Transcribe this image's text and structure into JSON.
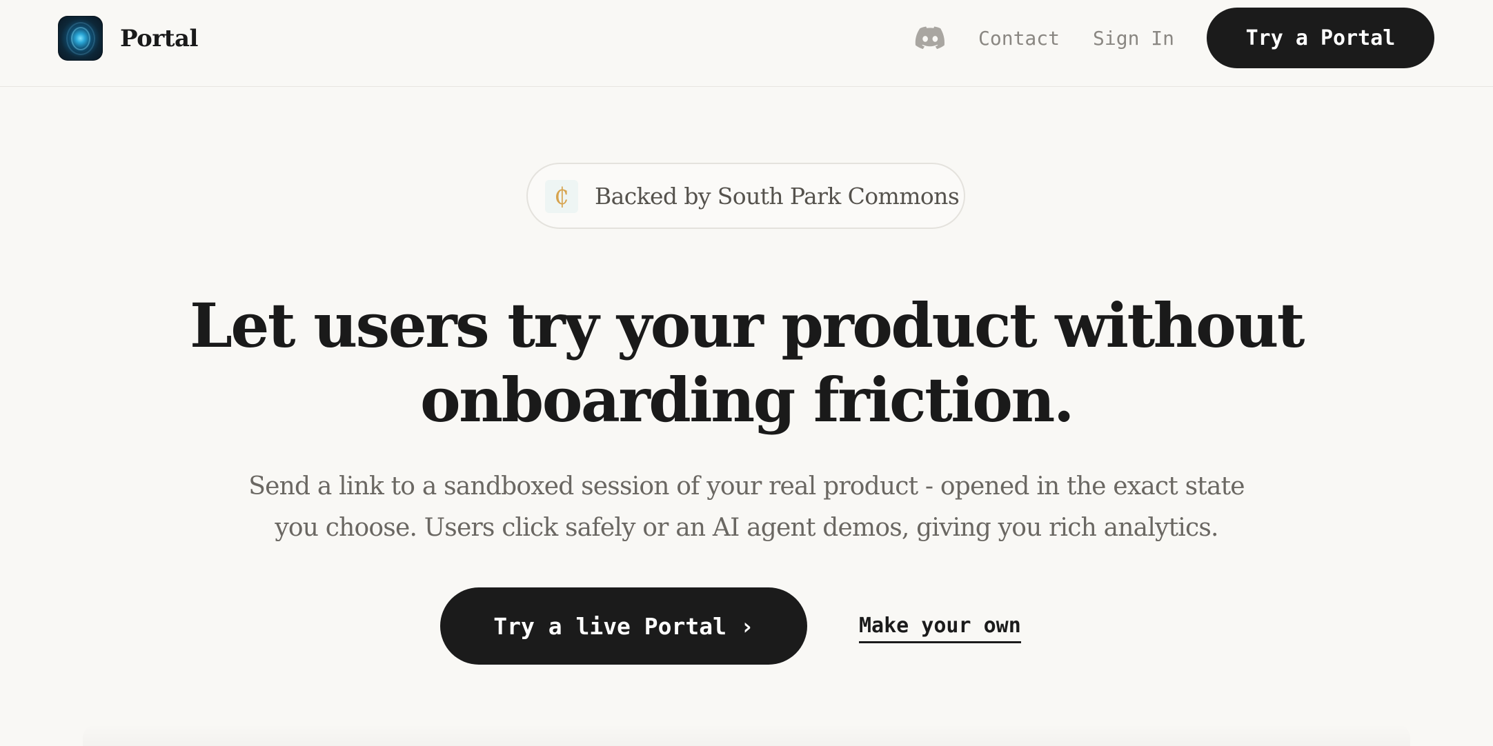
{
  "header": {
    "brand_name": "Portal",
    "nav": {
      "contact": "Contact",
      "sign_in": "Sign In"
    },
    "cta_label": "Try a Portal",
    "icons": {
      "logo": "portal-logo-icon",
      "discord": "discord-icon"
    }
  },
  "badge": {
    "text": "Backed by South Park Commons",
    "logo_glyph": "₵"
  },
  "hero": {
    "title_line1": "Let users try your product without",
    "title_line2": "onboarding friction.",
    "subtitle_line1": "Send a link to a sandboxed session of your real product - opened in the exact state",
    "subtitle_line2": "you choose. Users click safely or an AI agent demos, giving you rich analytics."
  },
  "actions": {
    "primary_label": "Try a live Portal ›",
    "secondary_label": "Make your own"
  },
  "colors": {
    "background": "#f9f8f5",
    "primary_button": "#1b1b1b",
    "muted_text": "#8a8782",
    "subtitle_text": "#6a6762",
    "badge_border": "#e4e2dd"
  }
}
